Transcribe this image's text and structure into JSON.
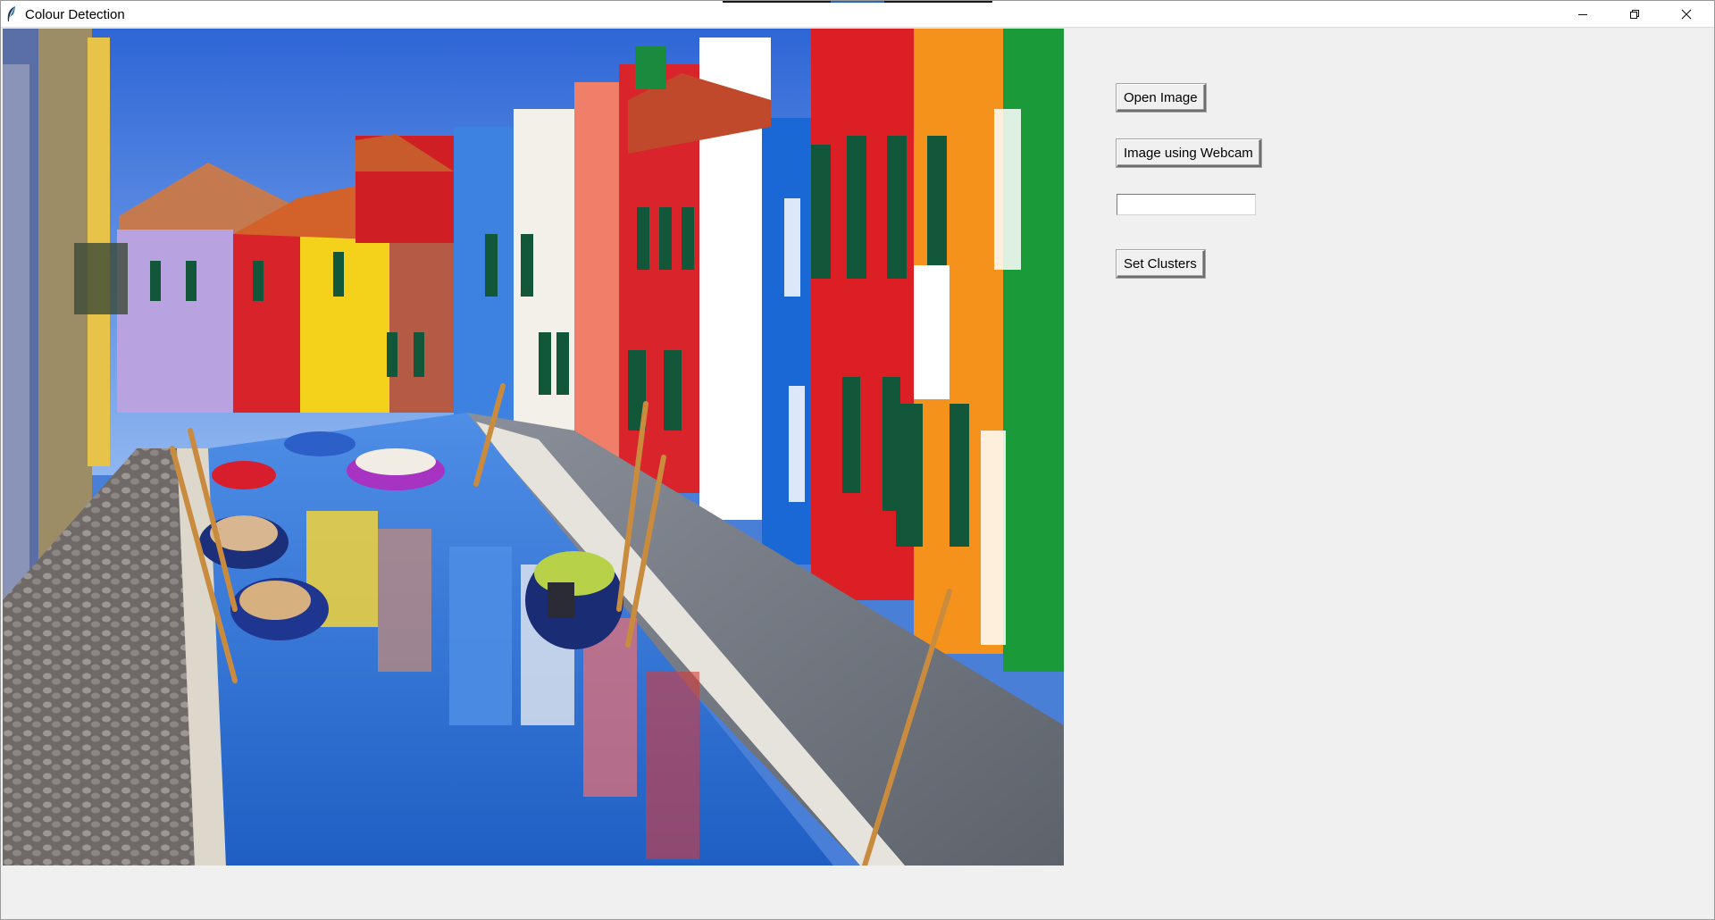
{
  "window": {
    "title": "Colour Detection",
    "controls": {
      "minimize_icon": "minimize-icon",
      "maximize_icon": "restore-icon",
      "close_icon": "close-icon"
    }
  },
  "image_panel": {
    "description_icon": "canal-photo"
  },
  "controls": {
    "open_image_label": "Open Image",
    "webcam_label": "Image using Webcam",
    "clusters_input_value": "",
    "set_clusters_label": "Set Clusters"
  },
  "colors": {
    "window_bg": "#f0f0f0",
    "titlebar_bg": "#ffffff"
  }
}
